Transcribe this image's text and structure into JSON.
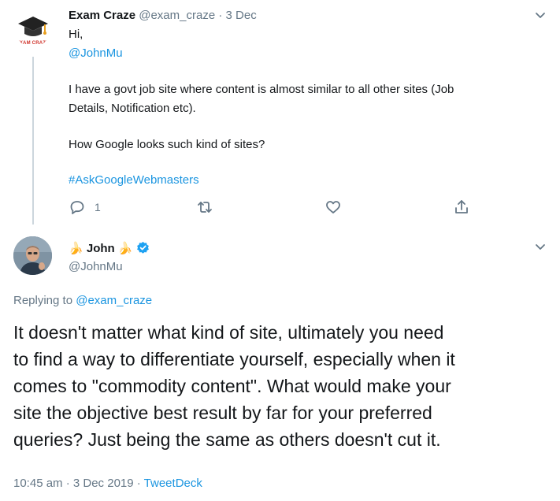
{
  "reply_tweet": {
    "author_name": "Exam Craze",
    "handle": "@exam_craze",
    "separator": "·",
    "date": "3 Dec",
    "avatar_caption": "EXAM CRAZE",
    "greeting": "Hi,",
    "mention": "@JohnMu",
    "body_line1": "I have a govt job site where content is almost similar to all other sites (Job",
    "body_line2": "Details, Notification etc).",
    "question": "How Google looks such kind of sites?",
    "hashtag": "#AskGoogleWebmasters",
    "reply_count": "1"
  },
  "main_tweet": {
    "author_name": "John",
    "emoji": "🍌",
    "handle": "@JohnMu",
    "replying_prefix": "Replying to",
    "replying_to": "@exam_craze",
    "text_lines": [
      "It doesn't matter what kind of site, ultimately you need",
      "to find a way to differentiate yourself, especially when it",
      "comes to \"commodity content\". What would make your",
      "site the objective best result by far for your preferred",
      "queries? Just being the same as others doesn't cut it."
    ],
    "time_date": "10:45 am · 3 Dec 2019",
    "separator": "·",
    "source": "TweetDeck"
  },
  "colors": {
    "link": "#1b95e0",
    "muted": "#657786",
    "verified": "#1da1f2",
    "thread_line": "#ccd6dd"
  },
  "icons": [
    "graduation-cap-icon",
    "reply-icon",
    "retweet-icon",
    "like-icon",
    "share-icon",
    "chevron-down-icon",
    "verified-badge-icon",
    "banana-emoji"
  ]
}
